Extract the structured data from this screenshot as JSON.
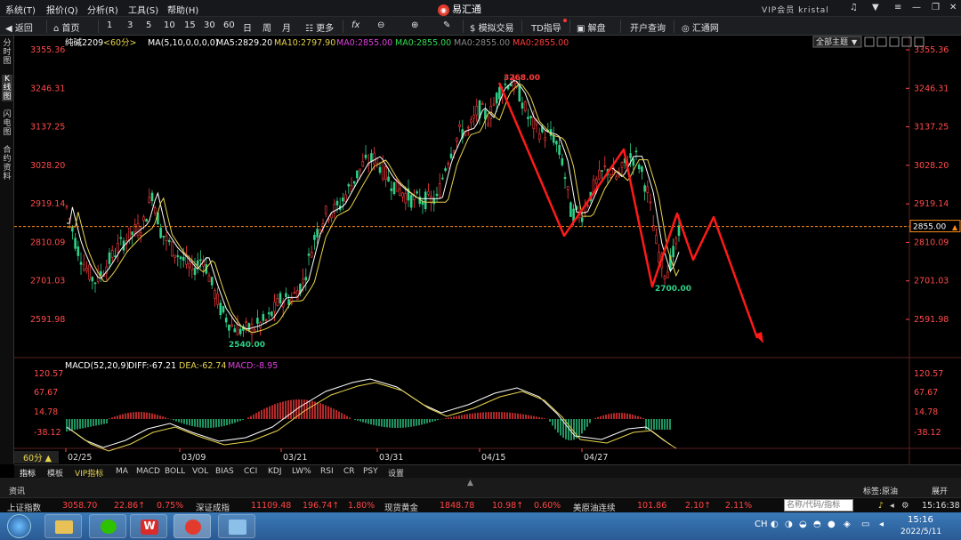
{
  "menu": {
    "items": [
      "系统(T)",
      "报价(Q)",
      "分析(R)",
      "工具(S)",
      "帮助(H)"
    ],
    "app_title": "易汇通",
    "vip_label": "VIP会员 kristal"
  },
  "toolbar": {
    "back": "返回",
    "home": "首页",
    "periods": [
      "1",
      "3",
      "5",
      "10",
      "15",
      "30",
      "60",
      "日",
      "周",
      "月"
    ],
    "more": "更多",
    "fx": "fx",
    "sim_trade": "模拟交易",
    "td_guide": "TD指导",
    "commentary": "解盘",
    "open_account": "开户查询",
    "site": "汇通网"
  },
  "sidebar": [
    "分时图",
    "K线图",
    "闪电图",
    "合约资料"
  ],
  "chart": {
    "symbol": "纯碱2209",
    "period_tag": "<60分>",
    "ma_params": "MA(5,10,0,0,0,0)",
    "ma5": "MA5:2829.20",
    "ma10": "MA10:2797.90",
    "ma0a": "MA0:2855.00",
    "ma0b": "MA0:2855.00",
    "ma0c": "MA0:2855.00",
    "ma0d": "MA0:2855.00",
    "main_theme": "全部主题",
    "price_ticks": [
      "3355.36",
      "3246.31",
      "3137.25",
      "3028.20",
      "2919.14",
      "2810.09",
      "2701.03",
      "2591.98"
    ],
    "current_price": "2855.00",
    "annot_high": "3268.00",
    "annot_low1": "2540.00",
    "annot_low2": "2700.00",
    "macd_label": "MACD(52,20,9)",
    "diff": "DIFF:-67.21",
    "dea": "DEA:-62.74",
    "macd": "MACD:-8.95",
    "macd_ticks": [
      "120.57",
      "67.67",
      "14.78",
      "-38.12"
    ],
    "date_ticks": [
      "02/25",
      "03/09",
      "03/21",
      "03/31",
      "04/15",
      "04/27"
    ],
    "period_button": "60分 ▲",
    "colors": {
      "up": "#ff3b3b",
      "down": "#2fd088",
      "ma5": "#ffffff",
      "ma10": "#e8d44d",
      "drawing": "#ff1a1a",
      "price_line": "#ff8a1a"
    }
  },
  "chart_data": {
    "type": "candlestick",
    "ylim": [
      2540,
      3355.36
    ],
    "x": [
      "02/25",
      "03/09",
      "03/21",
      "03/31",
      "04/15",
      "04/27"
    ],
    "series": [
      {
        "name": "MA5",
        "values": [
          2829.2
        ]
      },
      {
        "name": "MA10",
        "values": [
          2797.9
        ]
      }
    ],
    "annotations": [
      "3268.00",
      "2540.00",
      "2700.00"
    ]
  },
  "indicator_tabs": [
    "指标",
    "模板",
    "VIP指标",
    "MA",
    "MACD",
    "BOLL",
    "VOL",
    "BIAS",
    "CCI",
    "KDJ",
    "LW%",
    "RSI",
    "CR",
    "PSY",
    "设置"
  ],
  "infobar": {
    "news": "资讯",
    "tag": "标签:原油",
    "expand": "展开"
  },
  "ticker": [
    {
      "name": "上证指数",
      "price": "3058.70",
      "chg": "22.86↑",
      "pct": "0.75%"
    },
    {
      "name": "深证成指",
      "price": "11109.48",
      "chg": "196.74↑",
      "pct": "1.80%"
    },
    {
      "name": "现货黄金",
      "price": "1848.78",
      "chg": "10.98↑",
      "pct": "0.60%"
    },
    {
      "name": "美原油连续",
      "price": "101.86",
      "chg": "2.10↑",
      "pct": "2.11%"
    }
  ],
  "ticker_search_placeholder": "名称/代码/指标",
  "ticker_time": "15:16:38",
  "taskbar": {
    "lang": "CH",
    "time": "15:16",
    "date": "2022/5/11"
  }
}
